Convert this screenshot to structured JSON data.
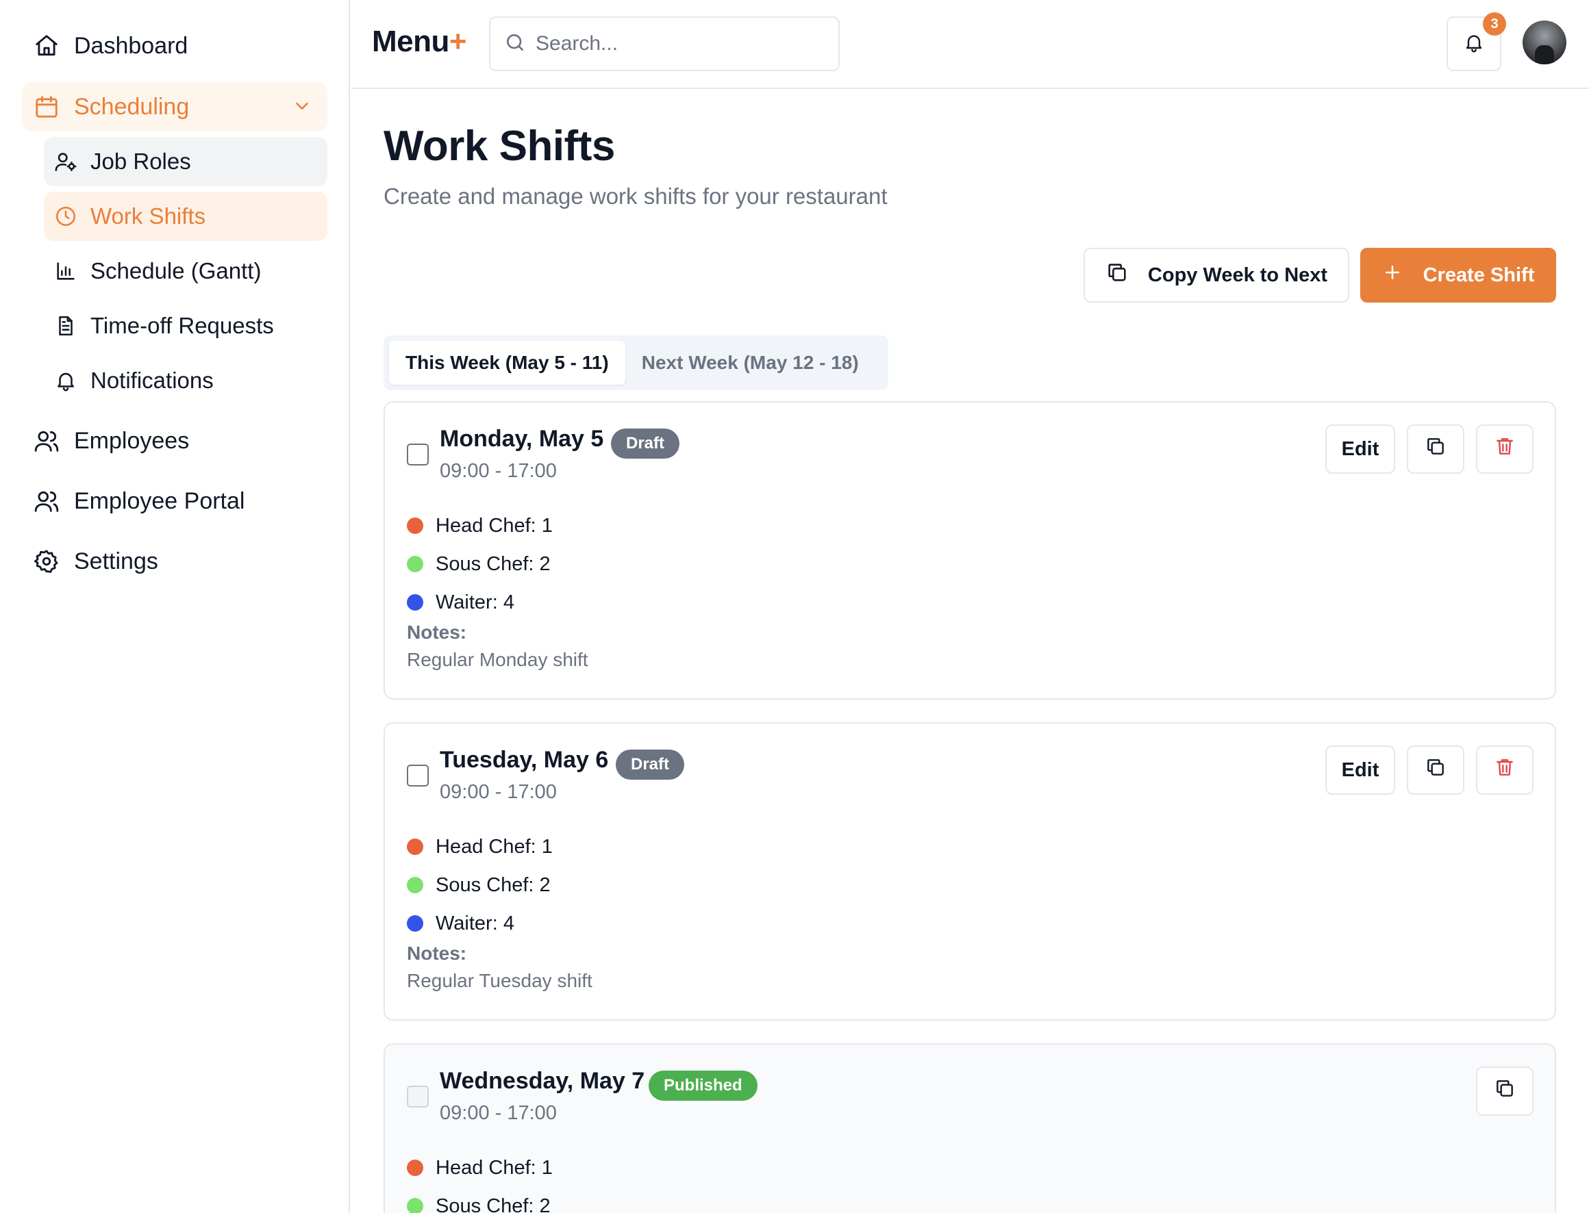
{
  "sidebar": {
    "dashboard": "Dashboard",
    "scheduling": "Scheduling",
    "job_roles": "Job Roles",
    "work_shifts": "Work Shifts",
    "schedule_gantt": "Schedule (Gantt)",
    "time_off": "Time-off Requests",
    "notifications": "Notifications",
    "employees": "Employees",
    "employee_portal": "Employee Portal",
    "settings": "Settings"
  },
  "header": {
    "brand": "Menu",
    "brand_plus": "+",
    "search_placeholder": "Search...",
    "notification_count": "3"
  },
  "page": {
    "title": "Work Shifts",
    "subtitle": "Create and manage work shifts for your restaurant",
    "copy_week_label": "Copy Week to Next",
    "create_shift_label": "Create Shift"
  },
  "tabs": [
    {
      "label": "This Week (May 5 - 11)",
      "active": true
    },
    {
      "label": "Next Week (May 12 - 18)",
      "active": false
    }
  ],
  "colors": {
    "accent": "#e8803a",
    "head_chef": "#e8623a",
    "sous_chef": "#7be36b",
    "waiter": "#3454e8",
    "draft": "#6b7280",
    "published": "#4caf50"
  },
  "shifts": [
    {
      "title": "Monday, May 5",
      "status": "Draft",
      "time": "09:00 - 17:00",
      "roles": [
        "Head Chef: 1",
        "Sous Chef: 2",
        "Waiter: 4"
      ],
      "notes_label": "Notes:",
      "notes": "Regular Monday shift",
      "edit_label": "Edit"
    },
    {
      "title": "Tuesday, May 6",
      "status": "Draft",
      "time": "09:00 - 17:00",
      "roles": [
        "Head Chef: 1",
        "Sous Chef: 2",
        "Waiter: 4"
      ],
      "notes_label": "Notes:",
      "notes": "Regular Tuesday shift",
      "edit_label": "Edit"
    },
    {
      "title": "Wednesday, May 7",
      "status": "Published",
      "time": "09:00 - 17:00",
      "roles": [
        "Head Chef: 1",
        "Sous Chef: 2"
      ]
    }
  ]
}
